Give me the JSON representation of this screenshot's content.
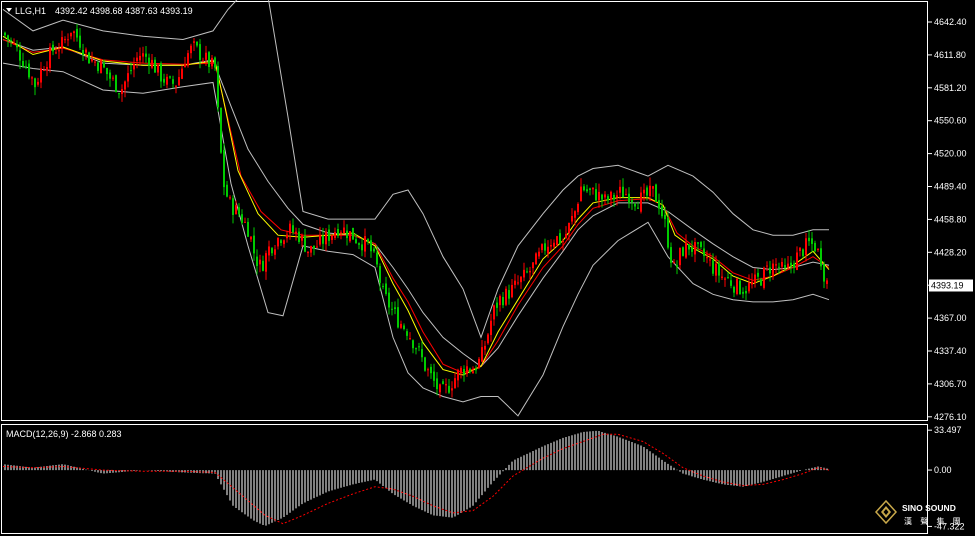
{
  "header": {
    "symbol": "LLG,H1",
    "ohlc": "4392.42 4398.68 4387.63 4393.19"
  },
  "macd_header": {
    "label": "MACD(12,26,9) -2.868 0.283"
  },
  "price_axis": {
    "ticks": [
      "4642.40",
      "4611.80",
      "4581.20",
      "4550.60",
      "4520.00",
      "4489.40",
      "4458.80",
      "4428.20",
      "4397.60",
      "4367.00",
      "4337.40",
      "4306.70",
      "4276.10"
    ],
    "current_price": "4393.19"
  },
  "macd_axis": {
    "ticks": [
      "33.497",
      "0.00",
      "-47.322"
    ]
  },
  "logo": {
    "name": "SINO SOUND",
    "tagline": "漢 聲 集 團"
  },
  "colors": {
    "background": "#000000",
    "bull_candle": "#ff0000",
    "bear_candle": "#00cc00",
    "bollinger": "#c0c0c0",
    "ma_fast": "#ffff00",
    "ma_slow": "#ff0000",
    "axis": "#ffffff",
    "macd_hist": "#ffffff",
    "macd_signal": "#ff0000",
    "price_label_bg": "#ffffff",
    "price_label_text": "#000000"
  },
  "chart_data": {
    "type": "candlestick",
    "timeframe": "H1",
    "ylim": [
      4270,
      4655
    ],
    "price_path": [
      [
        0,
        4628
      ],
      [
        10,
        4618
      ],
      [
        22,
        4600
      ],
      [
        32,
        4580
      ],
      [
        40,
        4598
      ],
      [
        50,
        4612
      ],
      [
        60,
        4618
      ],
      [
        68,
        4632
      ],
      [
        76,
        4622
      ],
      [
        86,
        4605
      ],
      [
        98,
        4598
      ],
      [
        108,
        4585
      ],
      [
        118,
        4575
      ],
      [
        126,
        4590
      ],
      [
        136,
        4608
      ],
      [
        146,
        4605
      ],
      [
        156,
        4590
      ],
      [
        166,
        4580
      ],
      [
        174,
        4582
      ],
      [
        182,
        4605
      ],
      [
        190,
        4615
      ],
      [
        198,
        4608
      ],
      [
        206,
        4600
      ],
      [
        212,
        4595
      ],
      [
        216,
        4540
      ],
      [
        220,
        4490
      ],
      [
        226,
        4470
      ],
      [
        236,
        4460
      ],
      [
        246,
        4445
      ],
      [
        252,
        4420
      ],
      [
        258,
        4410
      ],
      [
        266,
        4428
      ],
      [
        276,
        4438
      ],
      [
        286,
        4445
      ],
      [
        296,
        4440
      ],
      [
        306,
        4425
      ],
      [
        316,
        4432
      ],
      [
        326,
        4440
      ],
      [
        336,
        4448
      ],
      [
        346,
        4442
      ],
      [
        356,
        4435
      ],
      [
        366,
        4430
      ],
      [
        374,
        4410
      ],
      [
        380,
        4385
      ],
      [
        388,
        4372
      ],
      [
        396,
        4360
      ],
      [
        404,
        4352
      ],
      [
        414,
        4335
      ],
      [
        422,
        4318
      ],
      [
        430,
        4305
      ],
      [
        438,
        4292
      ],
      [
        446,
        4300
      ],
      [
        454,
        4310
      ],
      [
        462,
        4318
      ],
      [
        470,
        4315
      ],
      [
        478,
        4325
      ],
      [
        484,
        4345
      ],
      [
        490,
        4368
      ],
      [
        496,
        4380
      ],
      [
        504,
        4385
      ],
      [
        512,
        4392
      ],
      [
        520,
        4400
      ],
      [
        528,
        4408
      ],
      [
        536,
        4420
      ],
      [
        544,
        4432
      ],
      [
        552,
        4438
      ],
      [
        560,
        4435
      ],
      [
        566,
        4448
      ],
      [
        572,
        4462
      ],
      [
        578,
        4485
      ],
      [
        586,
        4480
      ],
      [
        594,
        4478
      ],
      [
        602,
        4472
      ],
      [
        610,
        4475
      ],
      [
        618,
        4480
      ],
      [
        626,
        4478
      ],
      [
        634,
        4472
      ],
      [
        642,
        4475
      ],
      [
        650,
        4480
      ],
      [
        656,
        4470
      ],
      [
        662,
        4450
      ],
      [
        668,
        4420
      ],
      [
        672,
        4405
      ],
      [
        678,
        4425
      ],
      [
        686,
        4430
      ],
      [
        694,
        4425
      ],
      [
        702,
        4420
      ],
      [
        710,
        4410
      ],
      [
        718,
        4402
      ],
      [
        726,
        4398
      ],
      [
        734,
        4392
      ],
      [
        742,
        4390
      ],
      [
        750,
        4395
      ],
      [
        758,
        4400
      ],
      [
        766,
        4410
      ],
      [
        774,
        4412
      ],
      [
        782,
        4405
      ],
      [
        790,
        4415
      ],
      [
        798,
        4425
      ],
      [
        806,
        4432
      ],
      [
        812,
        4430
      ],
      [
        818,
        4418
      ],
      [
        822,
        4400
      ],
      [
        826,
        4393
      ]
    ],
    "bollinger_upper": [
      [
        0,
        4650
      ],
      [
        30,
        4630
      ],
      [
        60,
        4640
      ],
      [
        100,
        4630
      ],
      [
        140,
        4625
      ],
      [
        180,
        4622
      ],
      [
        210,
        4630
      ],
      [
        225,
        4650
      ],
      [
        240,
        4665
      ],
      [
        265,
        4662
      ],
      [
        285,
        4550
      ],
      [
        300,
        4462
      ],
      [
        325,
        4455
      ],
      [
        350,
        4455
      ],
      [
        372,
        4455
      ],
      [
        390,
        4478
      ],
      [
        405,
        4482
      ],
      [
        420,
        4460
      ],
      [
        440,
        4420
      ],
      [
        460,
        4390
      ],
      [
        478,
        4345
      ],
      [
        495,
        4390
      ],
      [
        515,
        4430
      ],
      [
        540,
        4460
      ],
      [
        560,
        4482
      ],
      [
        575,
        4495
      ],
      [
        590,
        4502
      ],
      [
        615,
        4505
      ],
      [
        645,
        4495
      ],
      [
        665,
        4505
      ],
      [
        690,
        4495
      ],
      [
        710,
        4480
      ],
      [
        730,
        4460
      ],
      [
        750,
        4445
      ],
      [
        770,
        4440
      ],
      [
        790,
        4440
      ],
      [
        810,
        4445
      ],
      [
        826,
        4445
      ]
    ],
    "bollinger_mid": [
      [
        0,
        4622
      ],
      [
        30,
        4612
      ],
      [
        60,
        4615
      ],
      [
        100,
        4600
      ],
      [
        140,
        4598
      ],
      [
        180,
        4598
      ],
      [
        210,
        4603
      ],
      [
        228,
        4560
      ],
      [
        245,
        4520
      ],
      [
        265,
        4490
      ],
      [
        285,
        4465
      ],
      [
        300,
        4450
      ],
      [
        325,
        4442
      ],
      [
        350,
        4440
      ],
      [
        372,
        4432
      ],
      [
        390,
        4410
      ],
      [
        405,
        4390
      ],
      [
        420,
        4368
      ],
      [
        440,
        4345
      ],
      [
        460,
        4330
      ],
      [
        478,
        4318
      ],
      [
        495,
        4335
      ],
      [
        515,
        4365
      ],
      [
        540,
        4400
      ],
      [
        560,
        4425
      ],
      [
        575,
        4445
      ],
      [
        590,
        4458
      ],
      [
        615,
        4470
      ],
      [
        645,
        4470
      ],
      [
        665,
        4462
      ],
      [
        690,
        4445
      ],
      [
        710,
        4432
      ],
      [
        730,
        4420
      ],
      [
        750,
        4410
      ],
      [
        770,
        4408
      ],
      [
        790,
        4410
      ],
      [
        810,
        4415
      ],
      [
        826,
        4412
      ]
    ],
    "bollinger_lower": [
      [
        0,
        4600
      ],
      [
        30,
        4595
      ],
      [
        60,
        4592
      ],
      [
        100,
        4575
      ],
      [
        140,
        4572
      ],
      [
        180,
        4578
      ],
      [
        210,
        4582
      ],
      [
        228,
        4488
      ],
      [
        245,
        4430
      ],
      [
        265,
        4368
      ],
      [
        280,
        4365
      ],
      [
        300,
        4430
      ],
      [
        325,
        4425
      ],
      [
        350,
        4422
      ],
      [
        372,
        4410
      ],
      [
        390,
        4345
      ],
      [
        405,
        4312
      ],
      [
        420,
        4298
      ],
      [
        440,
        4290
      ],
      [
        460,
        4285
      ],
      [
        478,
        4290
      ],
      [
        495,
        4290
      ],
      [
        515,
        4272
      ],
      [
        540,
        4310
      ],
      [
        560,
        4355
      ],
      [
        575,
        4385
      ],
      [
        590,
        4412
      ],
      [
        615,
        4435
      ],
      [
        645,
        4452
      ],
      [
        665,
        4420
      ],
      [
        690,
        4395
      ],
      [
        710,
        4385
      ],
      [
        730,
        4380
      ],
      [
        750,
        4378
      ],
      [
        770,
        4378
      ],
      [
        790,
        4380
      ],
      [
        810,
        4385
      ],
      [
        826,
        4380
      ]
    ],
    "ma_fast": [
      [
        0,
        4625
      ],
      [
        30,
        4608
      ],
      [
        60,
        4615
      ],
      [
        100,
        4602
      ],
      [
        140,
        4598
      ],
      [
        180,
        4598
      ],
      [
        212,
        4602
      ],
      [
        220,
        4568
      ],
      [
        235,
        4500
      ],
      [
        255,
        4460
      ],
      [
        275,
        4440
      ],
      [
        300,
        4438
      ],
      [
        325,
        4440
      ],
      [
        350,
        4442
      ],
      [
        372,
        4430
      ],
      [
        390,
        4395
      ],
      [
        405,
        4370
      ],
      [
        420,
        4340
      ],
      [
        440,
        4315
      ],
      [
        460,
        4310
      ],
      [
        478,
        4318
      ],
      [
        495,
        4350
      ],
      [
        515,
        4380
      ],
      [
        540,
        4418
      ],
      [
        560,
        4435
      ],
      [
        575,
        4455
      ],
      [
        590,
        4470
      ],
      [
        615,
        4475
      ],
      [
        645,
        4475
      ],
      [
        660,
        4468
      ],
      [
        672,
        4440
      ],
      [
        690,
        4428
      ],
      [
        710,
        4418
      ],
      [
        730,
        4402
      ],
      [
        750,
        4395
      ],
      [
        770,
        4402
      ],
      [
        790,
        4412
      ],
      [
        810,
        4425
      ],
      [
        826,
        4408
      ]
    ],
    "ma_slow": [
      [
        0,
        4622
      ],
      [
        30,
        4610
      ],
      [
        60,
        4614
      ],
      [
        100,
        4603
      ],
      [
        140,
        4600
      ],
      [
        180,
        4599
      ],
      [
        212,
        4600
      ],
      [
        222,
        4560
      ],
      [
        238,
        4495
      ],
      [
        258,
        4462
      ],
      [
        278,
        4445
      ],
      [
        300,
        4440
      ],
      [
        325,
        4440
      ],
      [
        350,
        4440
      ],
      [
        372,
        4432
      ],
      [
        390,
        4400
      ],
      [
        405,
        4378
      ],
      [
        420,
        4350
      ],
      [
        440,
        4320
      ],
      [
        460,
        4312
      ],
      [
        478,
        4318
      ],
      [
        495,
        4342
      ],
      [
        515,
        4375
      ],
      [
        540,
        4410
      ],
      [
        560,
        4430
      ],
      [
        575,
        4450
      ],
      [
        590,
        4465
      ],
      [
        615,
        4472
      ],
      [
        645,
        4474
      ],
      [
        660,
        4468
      ],
      [
        674,
        4442
      ],
      [
        690,
        4430
      ],
      [
        710,
        4420
      ],
      [
        730,
        4405
      ],
      [
        750,
        4398
      ],
      [
        770,
        4402
      ],
      [
        790,
        4410
      ],
      [
        810,
        4420
      ],
      [
        826,
        4410
      ]
    ],
    "macd": {
      "ylim": [
        -52,
        37
      ],
      "histogram": [
        [
          0,
          5
        ],
        [
          30,
          2
        ],
        [
          60,
          5
        ],
        [
          100,
          -3
        ],
        [
          140,
          0
        ],
        [
          180,
          -2
        ],
        [
          212,
          -3
        ],
        [
          230,
          -30
        ],
        [
          250,
          -42
        ],
        [
          262,
          -47
        ],
        [
          280,
          -40
        ],
        [
          300,
          -28
        ],
        [
          325,
          -18
        ],
        [
          350,
          -12
        ],
        [
          372,
          -8
        ],
        [
          390,
          -20
        ],
        [
          410,
          -30
        ],
        [
          430,
          -38
        ],
        [
          450,
          -40
        ],
        [
          470,
          -30
        ],
        [
          490,
          -10
        ],
        [
          510,
          8
        ],
        [
          540,
          20
        ],
        [
          560,
          27
        ],
        [
          580,
          32
        ],
        [
          595,
          33
        ],
        [
          615,
          28
        ],
        [
          640,
          20
        ],
        [
          660,
          8
        ],
        [
          680,
          -3
        ],
        [
          700,
          -8
        ],
        [
          720,
          -12
        ],
        [
          740,
          -14
        ],
        [
          760,
          -10
        ],
        [
          780,
          -5
        ],
        [
          800,
          0
        ],
        [
          815,
          3
        ],
        [
          826,
          1
        ]
      ],
      "signal": [
        [
          0,
          3
        ],
        [
          30,
          2
        ],
        [
          60,
          3
        ],
        [
          100,
          0
        ],
        [
          140,
          -1
        ],
        [
          180,
          -1
        ],
        [
          212,
          -2
        ],
        [
          240,
          -22
        ],
        [
          262,
          -38
        ],
        [
          280,
          -45
        ],
        [
          300,
          -38
        ],
        [
          325,
          -28
        ],
        [
          350,
          -20
        ],
        [
          372,
          -14
        ],
        [
          390,
          -16
        ],
        [
          410,
          -22
        ],
        [
          430,
          -30
        ],
        [
          450,
          -36
        ],
        [
          470,
          -34
        ],
        [
          490,
          -22
        ],
        [
          510,
          -5
        ],
        [
          540,
          10
        ],
        [
          560,
          18
        ],
        [
          580,
          24
        ],
        [
          600,
          30
        ],
        [
          615,
          30
        ],
        [
          640,
          24
        ],
        [
          660,
          14
        ],
        [
          680,
          2
        ],
        [
          700,
          -5
        ],
        [
          720,
          -10
        ],
        [
          740,
          -13
        ],
        [
          760,
          -12
        ],
        [
          780,
          -8
        ],
        [
          800,
          -3
        ],
        [
          815,
          2
        ],
        [
          826,
          0
        ]
      ]
    }
  }
}
